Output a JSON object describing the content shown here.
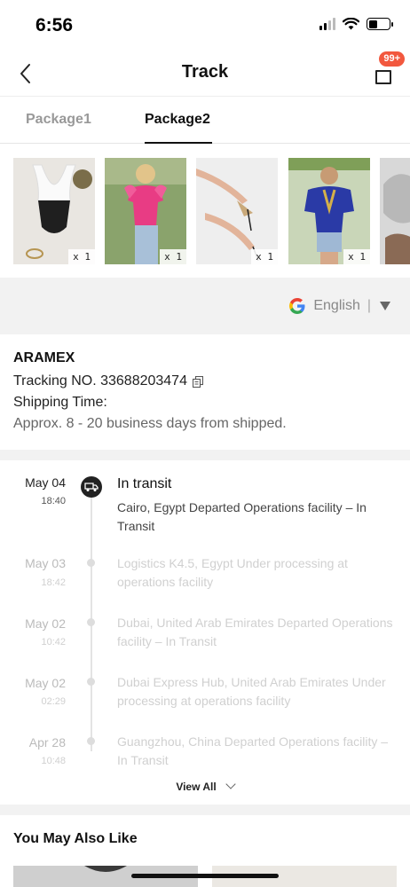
{
  "status_bar": {
    "time": "6:56"
  },
  "header": {
    "title": "Track",
    "bag_badge": "99+"
  },
  "tabs": [
    {
      "label": "Package1",
      "active": false
    },
    {
      "label": "Package2",
      "active": true
    }
  ],
  "products": [
    {
      "qty": "x 1"
    },
    {
      "qty": "x 1"
    },
    {
      "qty": "x 1"
    },
    {
      "qty": "x 1"
    },
    {
      "qty": ""
    }
  ],
  "translate": {
    "language": "English",
    "separator": "|"
  },
  "shipping": {
    "carrier": "ARAMEX",
    "tracking_label": "Tracking NO. 33688203474",
    "time_label": "Shipping Time:",
    "time_value": "Approx. 8 - 20 business days from shipped."
  },
  "timeline": [
    {
      "date": "May 04",
      "time": "18:40",
      "status": "In transit",
      "text": "Cairo, Egypt Departed Operations facility – In Transit"
    },
    {
      "date": "May 03",
      "time": "18:42",
      "text": "Logistics K4.5, Egypt Under processing at operations facility"
    },
    {
      "date": "May 02",
      "time": "10:42",
      "text": "Dubai, United Arab Emirates Departed Operations facility – In Transit"
    },
    {
      "date": "May 02",
      "time": "02:29",
      "text": "Dubai Express Hub, United Arab Emirates Under processing at operations facility"
    },
    {
      "date": "Apr 28",
      "time": "10:48",
      "text": "Guangzhou, China Departed Operations facility – In Transit"
    }
  ],
  "view_all": "View All",
  "recommendations": {
    "title": "You May Also Like"
  },
  "colors": {
    "badge": "#f2583e",
    "band": "#f2f2f2",
    "text_dark": "#111111"
  },
  "icons": [
    "back-arrow-icon",
    "shopping-bag-icon",
    "google-g-icon",
    "dropdown-triangle-icon",
    "copy-icon",
    "truck-icon",
    "chevron-down-icon"
  ]
}
